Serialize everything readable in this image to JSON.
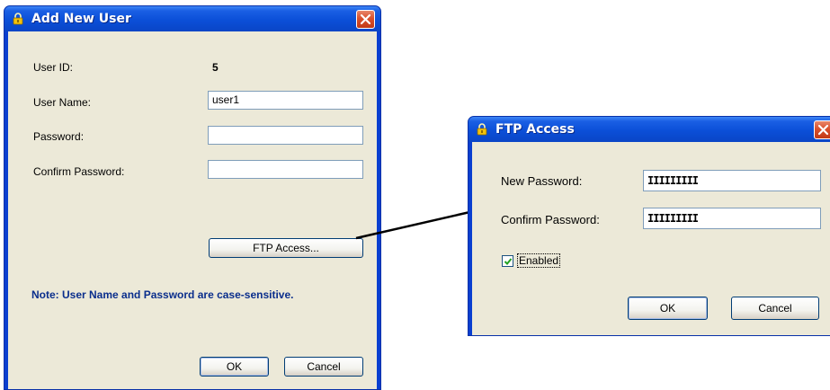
{
  "add_user_dialog": {
    "title": "Add New User",
    "user_id_label": "User ID:",
    "user_id_value": "5",
    "user_name_label": "User Name:",
    "user_name_value": "user1",
    "password_label": "Password:",
    "password_value": "",
    "confirm_password_label": "Confirm Password:",
    "confirm_password_value": "",
    "ftp_access_button": "FTP Access...",
    "note": "Note: User Name and Password are case-sensitive.",
    "ok_button": "OK",
    "cancel_button": "Cancel"
  },
  "ftp_access_dialog": {
    "title": "FTP Access",
    "new_password_label": "New Password:",
    "new_password_value": "IIIIIIIII",
    "confirm_password_label": "Confirm Password:",
    "confirm_password_value": "IIIIIIIII",
    "enabled_label": "Enabled",
    "enabled_checked": true,
    "ok_button": "OK",
    "cancel_button": "Cancel"
  },
  "icons": {
    "title_icon": "lock-icon",
    "close_icon": "close-icon",
    "check_icon": "check-icon"
  },
  "colors": {
    "titlebar": "#0b4fd8",
    "client": "#ece9d8",
    "note_text": "#0a2e8c",
    "close_button": "#d9502c"
  }
}
